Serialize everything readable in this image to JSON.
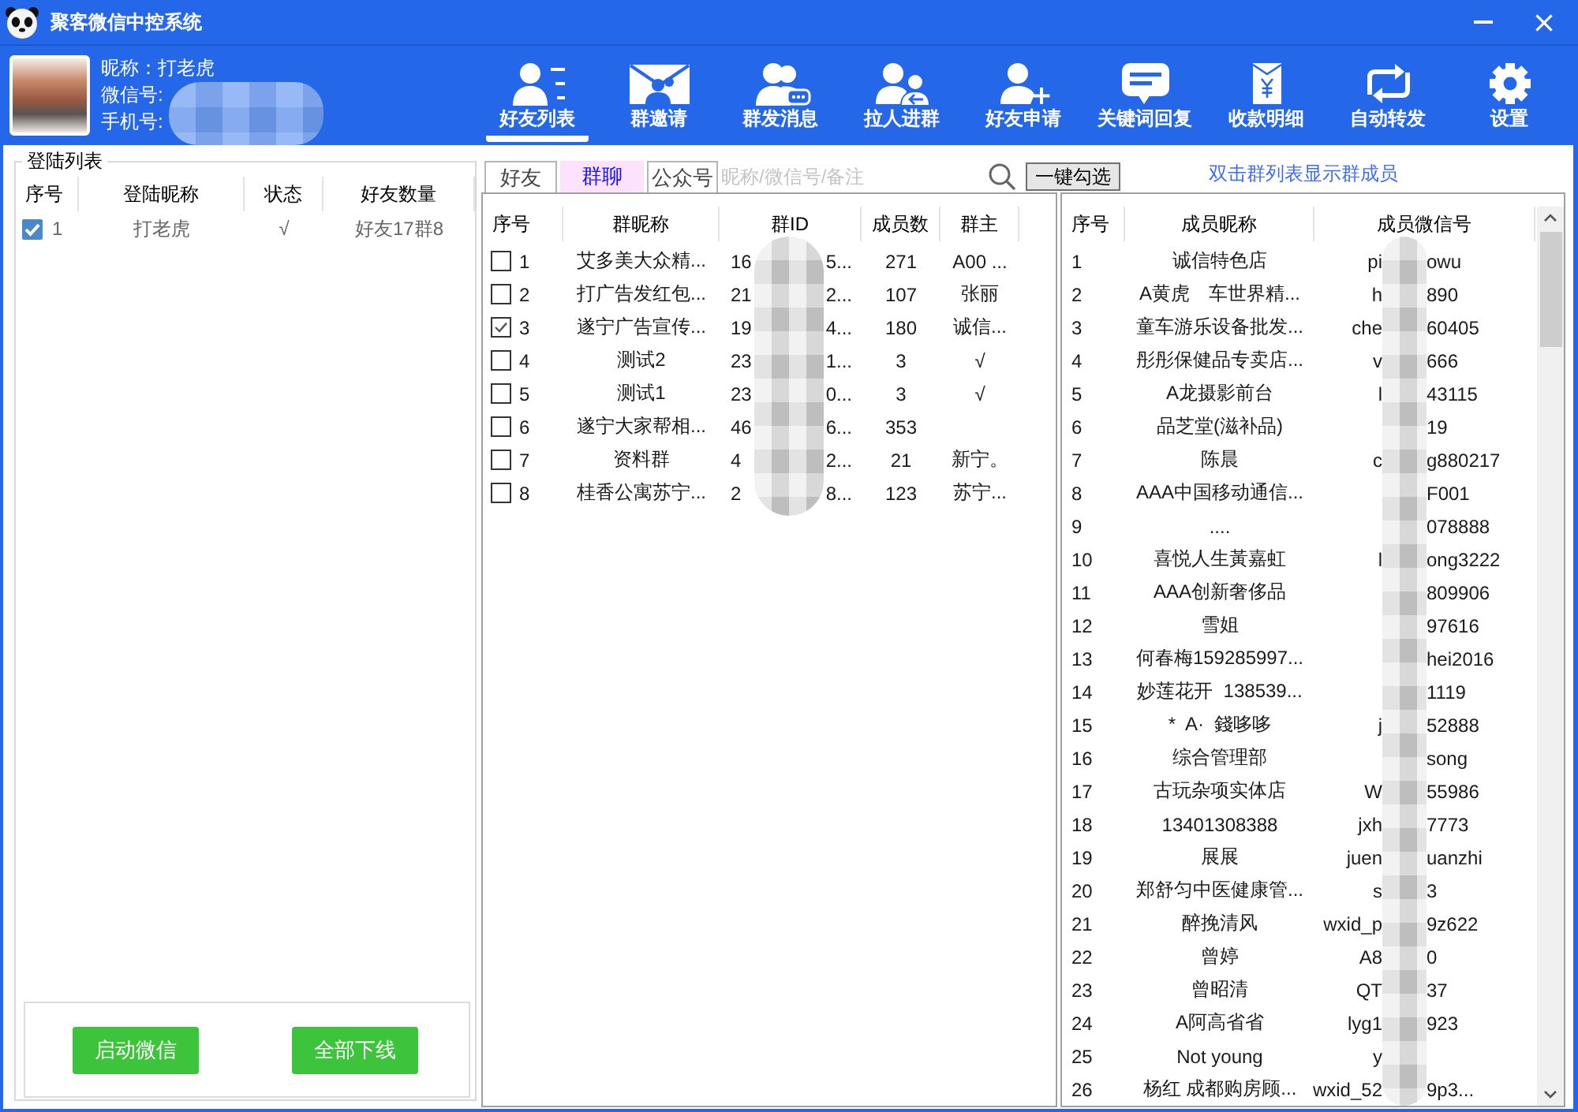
{
  "window": {
    "title": "聚客微信中控系统"
  },
  "profile": {
    "nickname": "昵称：打老虎",
    "wechat_label": "微信号:",
    "phone_label": "手机号:"
  },
  "toolbar": [
    {
      "label": "好友列表",
      "selected": true
    },
    {
      "label": "群邀请",
      "selected": false
    },
    {
      "label": "群发消息",
      "selected": false
    },
    {
      "label": "拉人进群",
      "selected": false
    },
    {
      "label": "好友申请",
      "selected": false
    },
    {
      "label": "关键词回复",
      "selected": false
    },
    {
      "label": "收款明细",
      "selected": false
    },
    {
      "label": "自动转发",
      "selected": false
    },
    {
      "label": "设置",
      "selected": false
    }
  ],
  "login_panel": {
    "title": "登陆列表",
    "columns": [
      "序号",
      "登陆昵称",
      "状态",
      "好友数量"
    ],
    "rows": [
      {
        "checked": true,
        "index": "1",
        "nickname": "打老虎",
        "status": "√",
        "counts": "好友17群8"
      }
    ],
    "buttons": [
      "启动微信",
      "全部下线"
    ]
  },
  "list_tabs": [
    {
      "label": "好友",
      "selected": false
    },
    {
      "label": "群聊",
      "selected": true
    },
    {
      "label": "公众号",
      "selected": false
    }
  ],
  "search": {
    "placeholder": "昵称/微信号/备注"
  },
  "select_all_button": "一键勾选",
  "hint": "双击群列表显示群成员",
  "group_table": {
    "columns": [
      "序号",
      "群昵称",
      "群ID",
      "成员数",
      "群主"
    ],
    "rows": [
      {
        "checked": false,
        "index": "1",
        "name": "艾多美大众精...",
        "id_start": "16",
        "id_end": "5...",
        "members": "271",
        "owner": "A00 ..."
      },
      {
        "checked": false,
        "index": "2",
        "name": "打广告发红包...",
        "id_start": "21",
        "id_end": "2...",
        "members": "107",
        "owner": "张丽"
      },
      {
        "checked": true,
        "index": "3",
        "name": "遂宁广告宣传...",
        "id_start": "19",
        "id_end": "4...",
        "members": "180",
        "owner": "诚信..."
      },
      {
        "checked": false,
        "index": "4",
        "name": "测试2",
        "id_start": "23",
        "id_end": "1...",
        "members": "3",
        "owner": "√"
      },
      {
        "checked": false,
        "index": "5",
        "name": "测试1",
        "id_start": "23",
        "id_end": "0...",
        "members": "3",
        "owner": "√"
      },
      {
        "checked": false,
        "index": "6",
        "name": "遂宁大家帮相...",
        "id_start": "46",
        "id_end": "6...",
        "members": "353"
      },
      {
        "checked": false,
        "index": "7",
        "name": "资料群",
        "id_start": "4",
        "id_end": "2...",
        "members": "21",
        "owner": "新宁。"
      },
      {
        "checked": false,
        "index": "8",
        "name": "桂香公寓苏宁...",
        "id_start": "2",
        "id_end": "8...",
        "members": "123",
        "owner": "苏宁..."
      }
    ]
  },
  "member_table": {
    "columns": [
      "序号",
      "成员昵称",
      "成员微信号"
    ],
    "rows": [
      {
        "index": "1",
        "nickname": "诚信特色店",
        "wxid_start": "pi",
        "wxid_end": "owu"
      },
      {
        "index": "2",
        "nickname": "A黄虎　车世界精...",
        "wxid_start": "h",
        "wxid_end": "890"
      },
      {
        "index": "3",
        "nickname": "童车游乐设备批发...",
        "wxid_start": "che",
        "wxid_end": "60405"
      },
      {
        "index": "4",
        "nickname": "彤彤保健品专卖店...",
        "wxid_start": "v",
        "wxid_end": "666"
      },
      {
        "index": "5",
        "nickname": "A龙摄影前台",
        "wxid_start": "l",
        "wxid_end": "43115"
      },
      {
        "index": "6",
        "nickname": "品芝堂(滋补品)",
        "wxid_end": "19"
      },
      {
        "index": "7",
        "nickname": "陈晨",
        "wxid_start": "c",
        "wxid_end": "g880217"
      },
      {
        "index": "8",
        "nickname": "AAA中国移动通信...",
        "wxid_end": "F001"
      },
      {
        "index": "9",
        "nickname": "....",
        "wxid_end": "078888"
      },
      {
        "index": "10",
        "nickname": "喜悦人生黃嘉虹",
        "wxid_start": "l",
        "wxid_end": "ong3222"
      },
      {
        "index": "11",
        "nickname": "AAA创新奢侈品",
        "wxid_end": "809906"
      },
      {
        "index": "12",
        "nickname": "雪姐",
        "wxid_end": "97616"
      },
      {
        "index": "13",
        "nickname": "何春梅159285997...",
        "wxid_end": "hei2016"
      },
      {
        "index": "14",
        "nickname": "妙莲花开  138539...",
        "wxid_end": "1119"
      },
      {
        "index": "15",
        "nickname": "*  A·  錢哆哆",
        "wxid_start": "j",
        "wxid_end": "52888"
      },
      {
        "index": "16",
        "nickname": "综合管理部",
        "wxid_end": "song"
      },
      {
        "index": "17",
        "nickname": "古玩杂项实体店",
        "wxid_start": "W",
        "wxid_end": "55986"
      },
      {
        "index": "18",
        "nickname": "13401308388",
        "wxid_start": "jxh",
        "wxid_end": "7773"
      },
      {
        "index": "19",
        "nickname": "展展",
        "wxid_start": "juen",
        "wxid_end": "uanzhi"
      },
      {
        "index": "20",
        "nickname": "郑舒匀中医健康管...",
        "wxid_start": "s",
        "wxid_end": "3"
      },
      {
        "index": "21",
        "nickname": "醉挽清风",
        "wxid_start": "wxid_p",
        "wxid_end": "9z622"
      },
      {
        "index": "22",
        "nickname": "曾婷",
        "wxid_start": "A8",
        "wxid_end": "0"
      },
      {
        "index": "23",
        "nickname": "曾昭清",
        "wxid_start": "QT",
        "wxid_end": "37"
      },
      {
        "index": "24",
        "nickname": "A阿高省省",
        "wxid_start": "lyg1",
        "wxid_end": "923"
      },
      {
        "index": "25",
        "nickname": "Not young",
        "wxid_start": "y"
      },
      {
        "index": "26",
        "nickname": "杨红 成都购房顾...",
        "wxid_start": "wxid_52",
        "wxid_end": "9p3..."
      }
    ]
  }
}
